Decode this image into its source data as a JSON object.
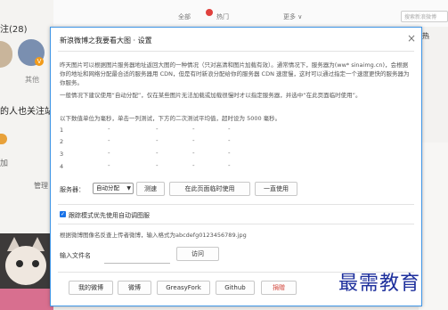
{
  "background": {
    "left_title": "注(28)",
    "left_name": "其他",
    "left_text2": "的人也关注站",
    "left_text3": "加",
    "left_text4": "管理",
    "nav": [
      "全部",
      "热门",
      "更多 ∨"
    ],
    "search_placeholder": "搜索新浪微博",
    "right_hot": "热"
  },
  "dialog": {
    "title": "新浪微博之我要看大图 · 设置",
    "close": "×",
    "paragraph1": "昨天图片可以根据图片服务器地址返回大图的一种情况（只对高清和图片加载有效）。通常情况下，服务器为(ww* sinaimg.cn)，会根据你的地址和网络分配最合适的服务器用 CDN，但是有时新浪分配给你的服务器 CDN 速度慢，这时可以通过指定一个速度更快的服务器为你服务。",
    "paragraph2": "一般情况下建议使用“自动分配”，仅在某些图片无法加载或加载很慢时才以指定服务器，并选中“在此页面临时使用”。",
    "test_note": "以下数值单位为毫秒，单击一列测试，下方的二次测试平均值，超时设为 5000 毫秒。",
    "test_rows": [
      {
        "label": "1",
        "values": [
          "-",
          "-",
          "-",
          "-"
        ]
      },
      {
        "label": "2",
        "values": [
          "-",
          "-",
          "-",
          "-"
        ]
      },
      {
        "label": "3",
        "values": [
          "-",
          "-",
          "-",
          "-"
        ]
      },
      {
        "label": "4",
        "values": [
          "-",
          "-",
          "-",
          "-"
        ]
      }
    ],
    "server_label": "服务器：",
    "server_selected": "自动分配",
    "btn_test": "测速",
    "btn_temp_use": "在此页面临时使用",
    "btn_always_use": "一直使用",
    "checkbox_label": "跟踪模式优先使用自动调图服",
    "filename_note": "根据微博图像名反查上传者微博，输入格式为abcdefg0123456789.jpg",
    "input_label": "输入文件名",
    "input_value": "",
    "btn_visit": "访问",
    "footer_buttons": [
      "我的微博",
      "微博",
      "GreasyFork",
      "Github",
      "捐赠"
    ],
    "footer_donate_color": "#d2463c",
    "accent_color": "#3e95e6"
  },
  "watermark": "最需教育"
}
